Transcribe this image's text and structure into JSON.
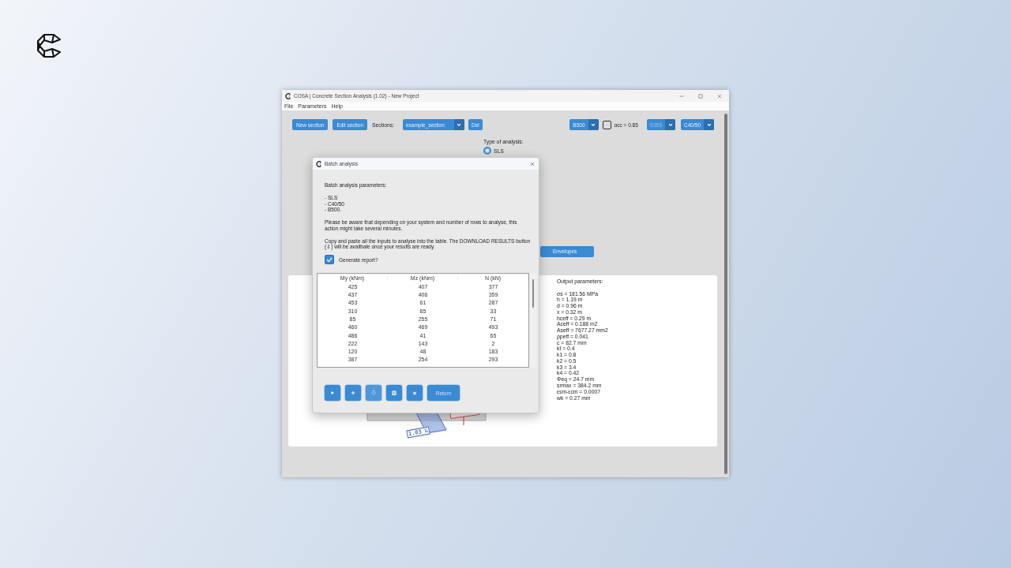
{
  "window": {
    "title": "COSA | Concrete Section Analysis (1.02) - New Project"
  },
  "menu": [
    "File",
    "Parameters",
    "Help"
  ],
  "toolbar": {
    "buttons": [
      "New section",
      "Edit section"
    ],
    "sections_label": "Sections:",
    "section_select": "example_section",
    "delete_button": "Del",
    "right_controls": [
      {
        "kind": "select",
        "value": "B500",
        "disabled": false
      },
      {
        "kind": "checkbox",
        "label": "αcc = 0.85",
        "checked": false
      },
      {
        "kind": "select",
        "value": "S355",
        "disabled": true
      },
      {
        "kind": "select",
        "value": "C40/50",
        "disabled": false
      }
    ]
  },
  "analysis": {
    "label": "Type of analysis:",
    "options": [
      {
        "label": "SLS",
        "selected": true
      }
    ]
  },
  "envelopes_button": "Envelopes",
  "diagram": {
    "labels": [
      "1.03 ‰"
    ]
  },
  "output": {
    "title": "Output parameters:",
    "lines": [
      "σs = 181.56 MPa",
      "h = 1.19 m",
      "d = 0.96 m",
      "x = 0.32 m",
      "hceff = 0.29 m",
      "Aceff = 0.188 m2",
      "Aseff = 7677.27 mm2",
      "ρpeff = 0.041",
      "c = 82.7 mm",
      "kt = 0.4",
      "k1 = 0.8",
      "k2 = 0.5",
      "k3 = 3.4",
      "k4 = 0.42",
      "Φeq = 24.7 mm",
      "srmax = 384.2 mm",
      "εsm-εcm = 0.0007",
      "wk = 0.27 mm"
    ]
  },
  "dialog": {
    "title": "Batch analysis",
    "heading": "Batch analysis parameters:",
    "parameters": [
      "- SLS",
      "- C40/50",
      "- B500."
    ],
    "paragraphs": [
      "Please be aware that depending on your system and number of rows to analyse, this action might take several minutes.",
      "Copy and paste all the inputs to analyse into the table. The DOWNLOAD RESULTS button (⇩) will be availbale once your results are ready."
    ],
    "generate_report": {
      "label": "Generate report?",
      "checked": true
    },
    "table": {
      "columns": [
        "My (kNm)",
        "Mz (kNm)",
        "N (kN)"
      ],
      "rows": [
        [
          "425",
          "407",
          "377"
        ],
        [
          "437",
          "406",
          "359"
        ],
        [
          "453",
          "61",
          "287"
        ],
        [
          "310",
          "85",
          "33"
        ],
        [
          "85",
          "255",
          "71"
        ],
        [
          "460",
          "469",
          "493"
        ],
        [
          "486",
          "41",
          "65"
        ],
        [
          "222",
          "143",
          "2"
        ],
        [
          "120",
          "48",
          "183"
        ],
        [
          "387",
          "254",
          "293"
        ]
      ]
    },
    "buttons": [
      {
        "kind": "run",
        "disabled": false
      },
      {
        "kind": "add",
        "disabled": false
      },
      {
        "kind": "download",
        "disabled": true
      },
      {
        "kind": "delete",
        "disabled": false
      },
      {
        "kind": "clear",
        "disabled": false
      },
      {
        "kind": "text",
        "label": "Return",
        "disabled": false
      }
    ]
  }
}
